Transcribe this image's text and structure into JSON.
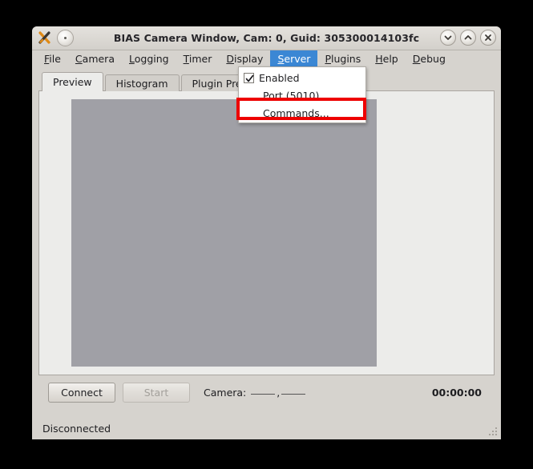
{
  "window": {
    "title": "BIAS Camera Window, Cam: 0, Guid: 305300014103fc",
    "app_icon": "bias-x-icon",
    "window_menu_button": "window-menu-dot-button",
    "buttons": {
      "minimize": "chevron-down-icon",
      "maximize": "chevron-up-icon",
      "close": "close-x-icon"
    }
  },
  "menubar": {
    "items": [
      {
        "label": "File",
        "mnemonic": "F",
        "rest": "ile",
        "active": false
      },
      {
        "label": "Camera",
        "mnemonic": "C",
        "rest": "amera",
        "active": false
      },
      {
        "label": "Logging",
        "mnemonic": "L",
        "rest": "ogging",
        "active": false
      },
      {
        "label": "Timer",
        "mnemonic": "T",
        "rest": "imer",
        "active": false
      },
      {
        "label": "Display",
        "mnemonic": "D",
        "rest": "isplay",
        "active": false
      },
      {
        "label": "Server",
        "mnemonic": "S",
        "rest": "erver",
        "active": true
      },
      {
        "label": "Plugins",
        "mnemonic": "P",
        "rest": "lugins",
        "active": false
      },
      {
        "label": "Help",
        "mnemonic": "H",
        "rest": "elp",
        "active": false
      },
      {
        "label": "Debug",
        "mnemonic": "D",
        "rest": "ebug",
        "active": false
      }
    ],
    "active_color": "#3b87d4"
  },
  "server_menu": {
    "open": true,
    "items": [
      {
        "label": "Enabled",
        "checked": true,
        "has_checkbox": true,
        "highlighted": false
      },
      {
        "label": "Port (5010)...",
        "checked": false,
        "has_checkbox": false,
        "highlighted": false
      },
      {
        "label": "Commands...",
        "checked": false,
        "has_checkbox": false,
        "highlighted": true
      }
    ]
  },
  "annotation": {
    "target": "Commands...",
    "color": "#ee0000"
  },
  "tabs": [
    {
      "label": "Preview",
      "selected": true
    },
    {
      "label": "Histogram",
      "selected": false
    },
    {
      "label": "Plugin Preview",
      "selected": false
    }
  ],
  "preview": {
    "image_fill": "#a0a0a6",
    "panel_fill": "#ececea"
  },
  "controls": {
    "connect_label": "Connect",
    "connect_enabled": true,
    "start_label": "Start",
    "start_enabled": false,
    "camera_label": "Camera:",
    "camera_value_1": "",
    "camera_value_2": "",
    "timer": "00:00:00"
  },
  "statusbar": {
    "text": "Disconnected"
  }
}
